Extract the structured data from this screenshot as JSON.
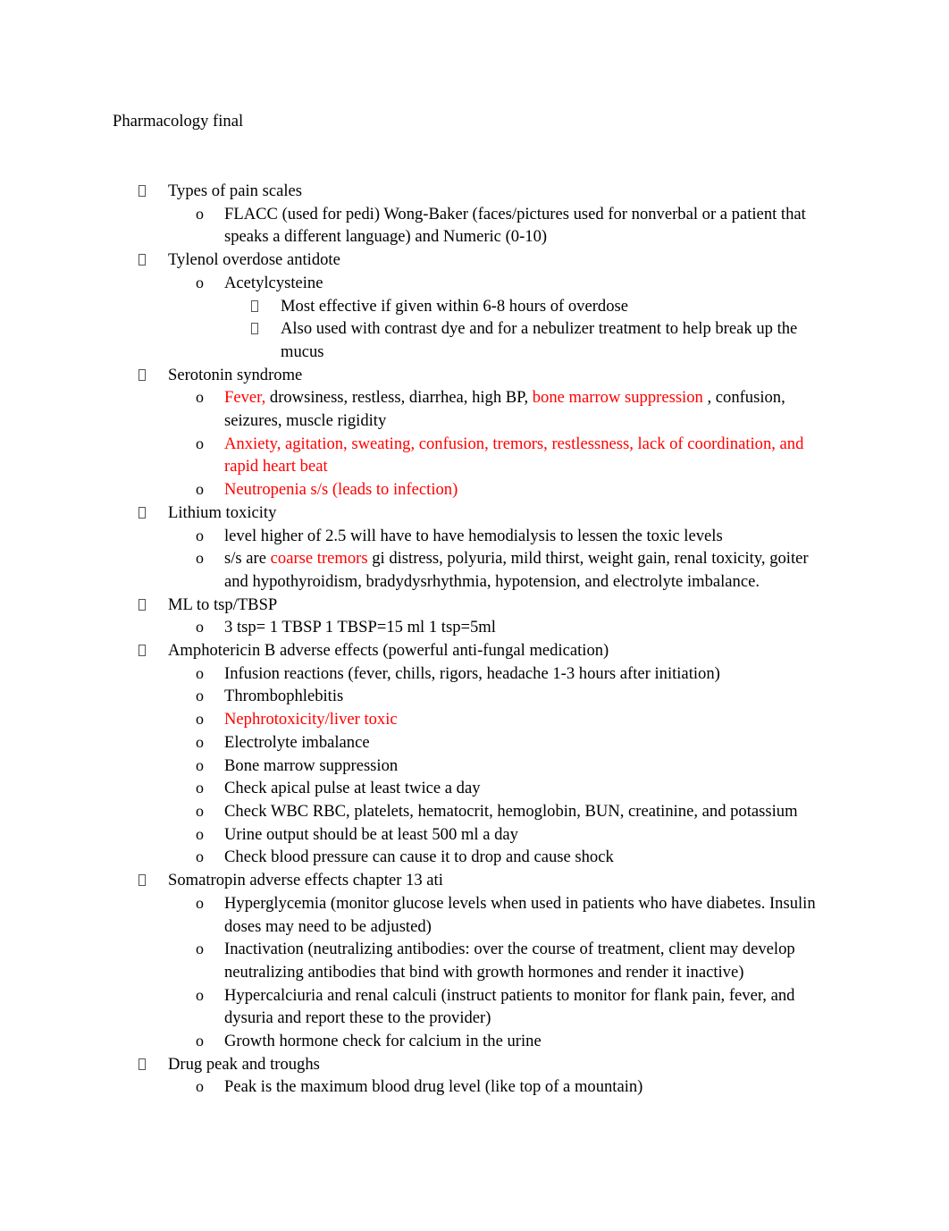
{
  "document": {
    "title": "Pharmacology final",
    "colors": {
      "text": "#000000",
      "highlight": "#ff0000"
    },
    "bullet_symbols": {
      "level1": "missing-glyph-box",
      "level2": "o",
      "level3": "missing-glyph-box"
    },
    "items": [
      {
        "level": 1,
        "runs": [
          {
            "text": "Types of pain scales",
            "red": false
          }
        ]
      },
      {
        "level": 2,
        "runs": [
          {
            "text": "FLACC (used for pedi) Wong-Baker (faces/pictures used for nonverbal or a patient that speaks a different language) and Numeric (0-10)",
            "red": false
          }
        ]
      },
      {
        "level": 1,
        "runs": [
          {
            "text": "Tylenol overdose antidote",
            "red": false
          }
        ]
      },
      {
        "level": 2,
        "runs": [
          {
            "text": "Acetylcysteine",
            "red": false
          }
        ]
      },
      {
        "level": 3,
        "runs": [
          {
            "text": "Most effective if given within 6-8 hours of overdose",
            "red": false
          }
        ]
      },
      {
        "level": 3,
        "runs": [
          {
            "text": "Also used with contrast dye and for a nebulizer treatment to help break up the mucus",
            "red": false
          }
        ]
      },
      {
        "level": 1,
        "runs": [
          {
            "text": "Serotonin syndrome",
            "red": false
          }
        ]
      },
      {
        "level": 2,
        "runs": [
          {
            "text": "Fever,",
            "red": true
          },
          {
            "text": " drowsiness, restless, diarrhea, high BP, ",
            "red": false
          },
          {
            "text": "bone marrow suppression",
            "red": true
          },
          {
            "text": " , confusion, seizures, muscle rigidity",
            "red": false
          }
        ]
      },
      {
        "level": 2,
        "runs": [
          {
            "text": "Anxiety, agitation, sweating, confusion, tremors, restlessness, lack of coordination, and rapid heart beat",
            "red": true
          }
        ]
      },
      {
        "level": 2,
        "runs": [
          {
            "text": "Neutropenia s/s (leads to infection)",
            "red": true
          }
        ]
      },
      {
        "level": 1,
        "runs": [
          {
            "text": "Lithium toxicity",
            "red": false
          }
        ]
      },
      {
        "level": 2,
        "runs": [
          {
            "text": "level higher of 2.5 will have to have hemodialysis to lessen the toxic levels",
            "red": false
          }
        ]
      },
      {
        "level": 2,
        "runs": [
          {
            "text": "s/s are ",
            "red": false
          },
          {
            "text": "coarse tremors",
            "red": true
          },
          {
            "text": "  gi distress, polyuria, mild thirst, weight gain, renal toxicity, goiter and hypothyroidism, bradydysrhythmia, hypotension, and electrolyte imbalance.",
            "red": false
          }
        ]
      },
      {
        "level": 1,
        "runs": [
          {
            "text": "ML to tsp/TBSP",
            "red": false
          }
        ]
      },
      {
        "level": 2,
        "runs": [
          {
            "text": "3 tsp= 1 TBSP 1 TBSP=15 ml 1 tsp=5ml",
            "red": false
          }
        ]
      },
      {
        "level": 1,
        "runs": [
          {
            "text": "Amphotericin B adverse effects (powerful anti-fungal medication)",
            "red": false
          }
        ]
      },
      {
        "level": 2,
        "runs": [
          {
            "text": "Infusion reactions (fever, chills, rigors, headache 1-3 hours after initiation)",
            "red": false
          }
        ]
      },
      {
        "level": 2,
        "runs": [
          {
            "text": "Thrombophlebitis",
            "red": false
          }
        ]
      },
      {
        "level": 2,
        "runs": [
          {
            "text": "Nephrotoxicity/liver toxic",
            "red": true
          }
        ]
      },
      {
        "level": 2,
        "runs": [
          {
            "text": "Electrolyte imbalance",
            "red": false
          }
        ]
      },
      {
        "level": 2,
        "runs": [
          {
            "text": "Bone marrow suppression",
            "red": false
          }
        ]
      },
      {
        "level": 2,
        "runs": [
          {
            "text": "Check apical pulse at least twice a day",
            "red": false
          }
        ]
      },
      {
        "level": 2,
        "runs": [
          {
            "text": "Check WBC RBC, platelets, hematocrit, hemoglobin, BUN, creatinine, and potassium",
            "red": false
          }
        ]
      },
      {
        "level": 2,
        "runs": [
          {
            "text": "Urine output should be at least 500 ml a day",
            "red": false
          }
        ]
      },
      {
        "level": 2,
        "runs": [
          {
            "text": "Check blood pressure can cause it to drop and cause shock",
            "red": false
          }
        ]
      },
      {
        "level": 1,
        "runs": [
          {
            "text": "Somatropin adverse effects chapter 13 ati",
            "red": false
          }
        ]
      },
      {
        "level": 2,
        "runs": [
          {
            "text": "Hyperglycemia (monitor glucose levels when used in patients who have diabetes. Insulin doses may need to be adjusted)",
            "red": false
          }
        ]
      },
      {
        "level": 2,
        "runs": [
          {
            "text": "Inactivation (neutralizing antibodies: over the course of treatment, client may develop neutralizing antibodies that bind with growth hormones and render it inactive)",
            "red": false
          }
        ]
      },
      {
        "level": 2,
        "runs": [
          {
            "text": "Hypercalciuria and renal calculi (instruct patients to monitor for flank pain, fever, and dysuria and report these to the provider)",
            "red": false
          }
        ]
      },
      {
        "level": 2,
        "runs": [
          {
            "text": "Growth hormone check for calcium in the urine",
            "red": false
          }
        ]
      },
      {
        "level": 1,
        "runs": [
          {
            "text": "Drug peak and troughs",
            "red": false
          }
        ]
      },
      {
        "level": 2,
        "runs": [
          {
            "text": "Peak is the maximum blood drug level (like top of a mountain)",
            "red": false
          }
        ]
      }
    ]
  }
}
